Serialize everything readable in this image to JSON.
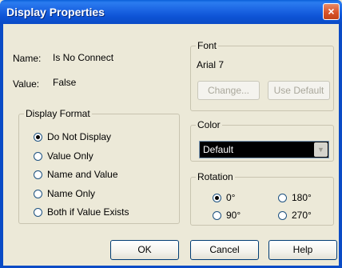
{
  "window": {
    "title": "Display Properties",
    "close_glyph": "×"
  },
  "name_row": {
    "label": "Name:",
    "value": "Is No Connect"
  },
  "value_row": {
    "label": "Value:",
    "value": "False"
  },
  "display_format": {
    "legend": "Display Format",
    "options": [
      {
        "label": "Do Not Display",
        "checked": true
      },
      {
        "label": "Value Only",
        "checked": false
      },
      {
        "label": "Name and Value",
        "checked": false
      },
      {
        "label": "Name Only",
        "checked": false
      },
      {
        "label": "Both if Value Exists",
        "checked": false
      }
    ]
  },
  "font": {
    "legend": "Font",
    "current": "Arial 7",
    "change_label": "Change...",
    "use_default_label": "Use Default"
  },
  "color": {
    "legend": "Color",
    "selected": "Default"
  },
  "rotation": {
    "legend": "Rotation",
    "options": [
      {
        "label": "0°",
        "checked": true
      },
      {
        "label": "180°",
        "checked": false
      },
      {
        "label": "90°",
        "checked": false
      },
      {
        "label": "270°",
        "checked": false
      }
    ]
  },
  "buttons": {
    "ok": "OK",
    "cancel": "Cancel",
    "help": "Help"
  },
  "colors": {
    "titlebar": "#0a4bc6",
    "dialog_bg": "#ece9d8",
    "close_button": "#d9542a"
  }
}
